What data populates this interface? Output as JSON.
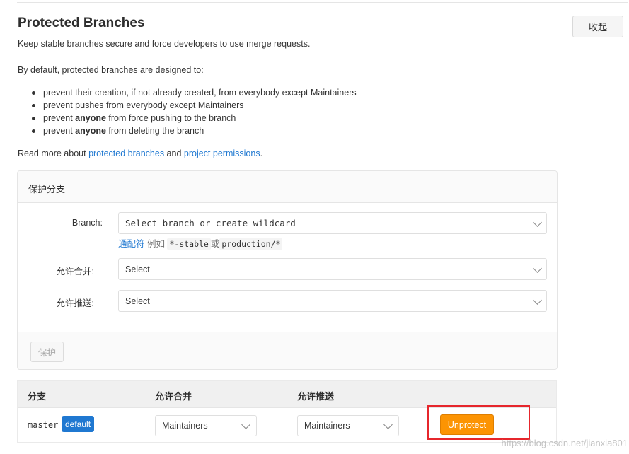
{
  "header": {
    "title": "Protected Branches",
    "subtitle": "Keep stable branches secure and force developers to use merge requests.",
    "collapse_label": "收起"
  },
  "intro": "By default, protected branches are designed to:",
  "rules": [
    {
      "pre": "prevent their creation, if not already created, from everybody except Maintainers",
      "bold": "",
      "post": ""
    },
    {
      "pre": "prevent pushes from everybody except Maintainers",
      "bold": "",
      "post": ""
    },
    {
      "pre": "prevent ",
      "bold": "anyone",
      "post": " from force pushing to the branch"
    },
    {
      "pre": "prevent ",
      "bold": "anyone",
      "post": " from deleting the branch"
    }
  ],
  "readmore": {
    "prefix": "Read more about ",
    "link1": "protected branches",
    "middle": " and ",
    "link2": "project permissions",
    "suffix": "."
  },
  "form": {
    "panel_title": "保护分支",
    "branch_label": "Branch:",
    "branch_placeholder": "Select branch or create wildcard",
    "hint_link": "通配符",
    "hint_text1": " 例如 ",
    "hint_code1": "*-stable",
    "hint_text2": "或",
    "hint_code2": "production/*",
    "merge_label": "允许合并:",
    "merge_value": "Select",
    "push_label": "允许推送:",
    "push_value": "Select",
    "protect_label": "保护"
  },
  "table": {
    "headers": [
      "分支",
      "允许合并",
      "允许推送"
    ],
    "rows": [
      {
        "branch": "master",
        "badge": "default",
        "merge": "Maintainers",
        "push": "Maintainers",
        "action": "Unprotect"
      }
    ]
  },
  "watermark": "https://blog.csdn.net/jianxia801",
  "colors": {
    "link": "#1f78d1",
    "badge": "#1f78d1",
    "unprotect": "#fc9403",
    "highlight": "#e6262c"
  }
}
